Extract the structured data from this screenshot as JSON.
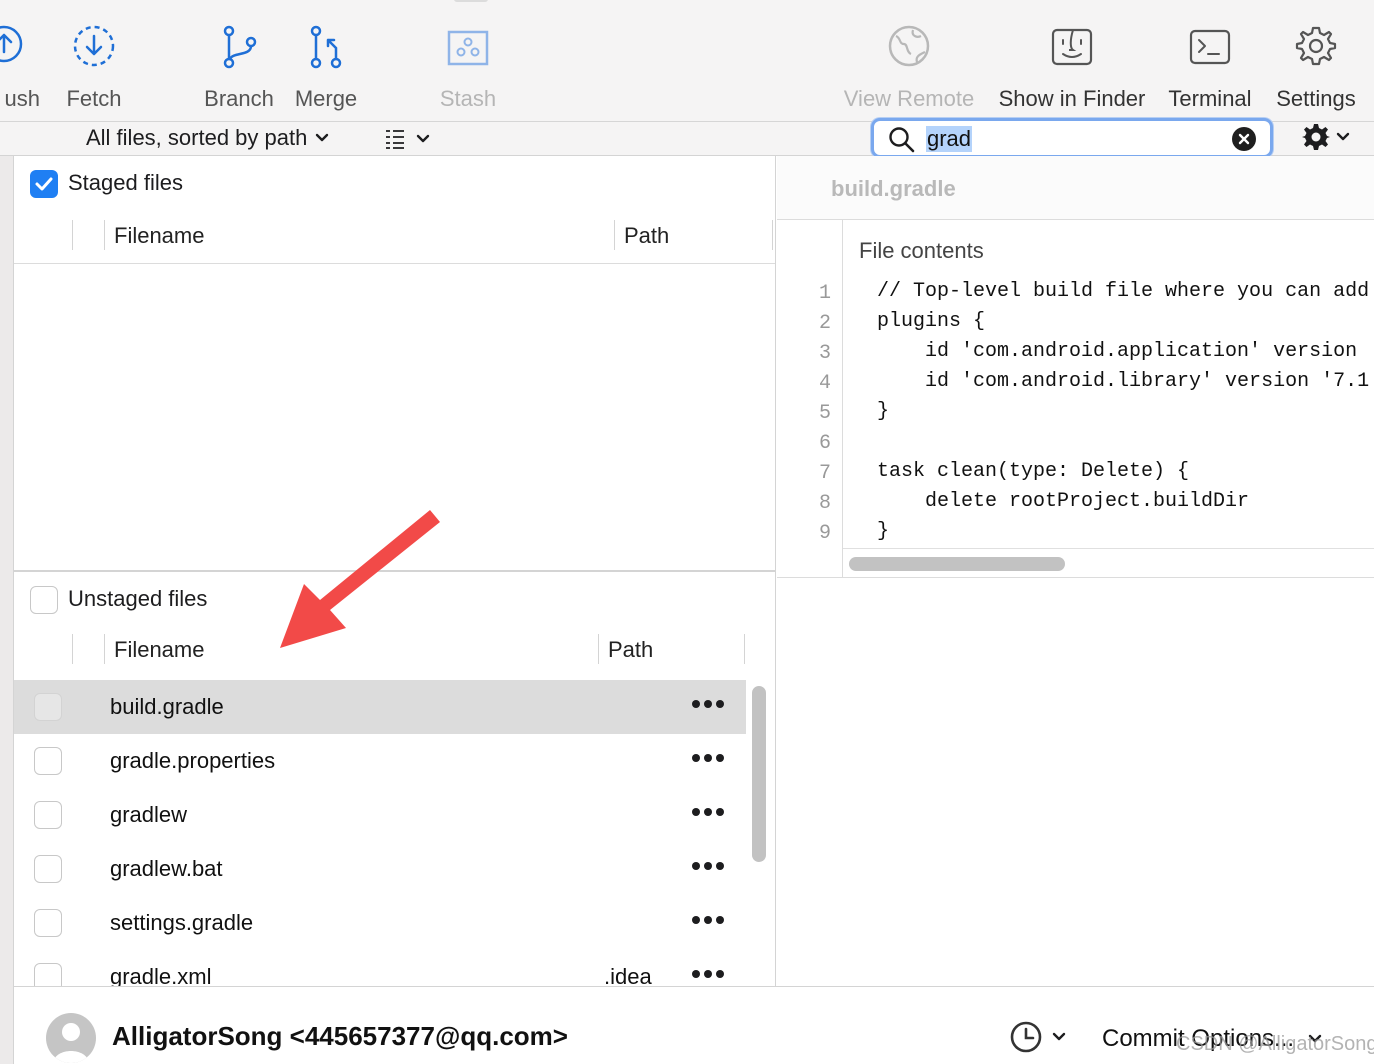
{
  "toolbar": {
    "buttons": [
      {
        "id": "push",
        "label": "ush",
        "icon": "push-icon",
        "state": "enabled"
      },
      {
        "id": "fetch",
        "label": "Fetch",
        "icon": "fetch-icon",
        "state": "enabled"
      },
      {
        "id": "branch",
        "label": "Branch",
        "icon": "branch-icon",
        "state": "enabled"
      },
      {
        "id": "merge",
        "label": "Merge",
        "icon": "merge-icon",
        "state": "enabled"
      },
      {
        "id": "stash",
        "label": "Stash",
        "icon": "stash-icon",
        "state": "disabled"
      },
      {
        "id": "view_remote",
        "label": "View Remote",
        "icon": "globe-icon",
        "state": "disabled"
      },
      {
        "id": "show_in_finder",
        "label": "Show in Finder",
        "icon": "finder-icon",
        "state": "enabled"
      },
      {
        "id": "terminal",
        "label": "Terminal",
        "icon": "terminal-icon",
        "state": "enabled"
      },
      {
        "id": "settings",
        "label": "Settings",
        "icon": "gear-icon",
        "state": "enabled"
      }
    ],
    "accent_color": "#1f6fd6"
  },
  "filter_bar": {
    "sort_label": "All files, sorted by path",
    "view_mode_icon": "list-view-icon",
    "search_value": "grad",
    "search_clear_icon": "clear-icon",
    "options_icon": "gear-icon"
  },
  "staged": {
    "checked": true,
    "title": "Staged files",
    "columns": {
      "filename": "Filename",
      "path": "Path"
    },
    "files": []
  },
  "unstaged": {
    "checked": false,
    "title": "Unstaged files",
    "columns": {
      "filename": "Filename",
      "path": "Path"
    },
    "files": [
      {
        "name": "build.gradle",
        "path": "",
        "selected": true
      },
      {
        "name": "gradle.properties",
        "path": "",
        "selected": false
      },
      {
        "name": "gradlew",
        "path": "",
        "selected": false
      },
      {
        "name": "gradlew.bat",
        "path": "",
        "selected": false
      },
      {
        "name": "settings.gradle",
        "path": "",
        "selected": false
      },
      {
        "name": "gradle.xml",
        "path": ".idea",
        "selected": false
      }
    ]
  },
  "preview": {
    "file_title": "build.gradle",
    "contents_label": "File contents",
    "lines": [
      {
        "n": "1",
        "text": "// Top-level build file where you can add"
      },
      {
        "n": "2",
        "text": "plugins {"
      },
      {
        "n": "3",
        "text": "    id 'com.android.application' version"
      },
      {
        "n": "4",
        "text": "    id 'com.android.library' version '7.1"
      },
      {
        "n": "5",
        "text": "}"
      },
      {
        "n": "6",
        "text": ""
      },
      {
        "n": "7",
        "text": "task clean(type: Delete) {"
      },
      {
        "n": "8",
        "text": "    delete rootProject.buildDir"
      },
      {
        "n": "9",
        "text": "}"
      }
    ]
  },
  "commit_bar": {
    "author": "AlligatorSong <445657377@qq.com>",
    "history_icon": "clock-icon",
    "commit_options_label": "Commit Options...",
    "watermark": "CSDN @AlligatorSong"
  },
  "annotation": {
    "arrow_color": "#f24a48"
  }
}
